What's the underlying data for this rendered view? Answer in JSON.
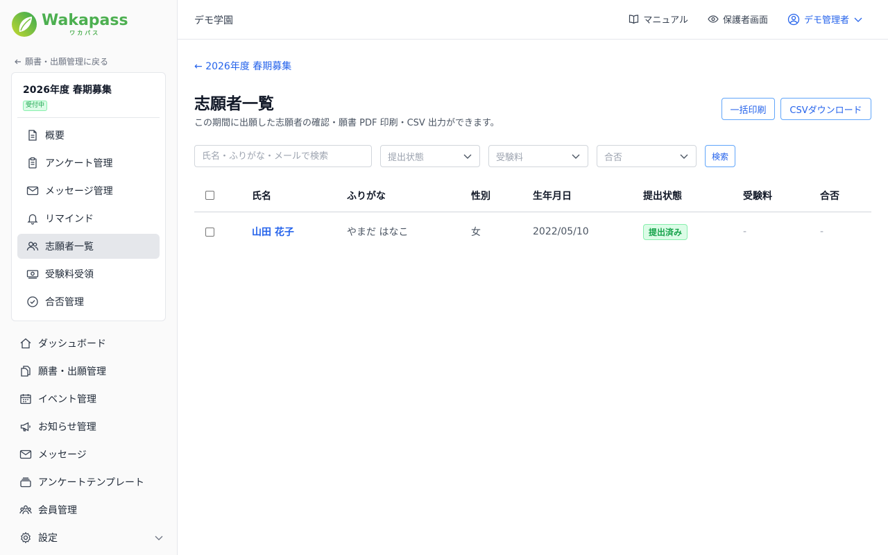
{
  "brand": {
    "name": "Wakapass",
    "kana": "ワカパス",
    "color": "#4caf50"
  },
  "sidebar": {
    "back_label": "願書・出願管理に戻る",
    "period": {
      "title": "2026年度 春期募集",
      "badge": "受付中",
      "items": [
        {
          "label": "概要",
          "icon": "document-icon"
        },
        {
          "label": "アンケート管理",
          "icon": "clipboard-icon"
        },
        {
          "label": "メッセージ管理",
          "icon": "mail-icon"
        },
        {
          "label": "リマインド",
          "icon": "bell-icon"
        },
        {
          "label": "志願者一覧",
          "icon": "users-icon",
          "active": true
        },
        {
          "label": "受験料受領",
          "icon": "cash-icon"
        },
        {
          "label": "合否管理",
          "icon": "check-circle-icon"
        }
      ]
    },
    "main_items": [
      {
        "label": "ダッシュボード",
        "icon": "home-icon"
      },
      {
        "label": "願書・出願管理",
        "icon": "documents-icon"
      },
      {
        "label": "イベント管理",
        "icon": "calendar-icon"
      },
      {
        "label": "お知らせ管理",
        "icon": "megaphone-icon"
      },
      {
        "label": "メッセージ",
        "icon": "mail-icon"
      },
      {
        "label": "アンケートテンプレート",
        "icon": "stack-icon"
      },
      {
        "label": "会員管理",
        "icon": "members-icon"
      },
      {
        "label": "設定",
        "icon": "gear-icon"
      }
    ]
  },
  "header": {
    "school": "デモ学園",
    "manual": "マニュアル",
    "guardian_view": "保護者画面",
    "user": "デモ管理者"
  },
  "main": {
    "crumb": "2026年度 春期募集",
    "title": "志願者一覧",
    "description": "この期間に出願した志願者の確認・願書 PDF 印刷・CSV 出力ができます。",
    "print_button": "一括印刷",
    "csv_button": "CSVダウンロード",
    "search_placeholder": "氏名・ふりがな・メールで検索",
    "filters": {
      "status": "提出状態",
      "fee": "受験料",
      "result": "合否"
    },
    "search_button": "検索"
  },
  "table": {
    "columns": [
      "氏名",
      "ふりがな",
      "性別",
      "生年月日",
      "提出状態",
      "受験料",
      "合否"
    ],
    "rows": [
      {
        "name": "山田 花子",
        "kana": "やまだ はなこ",
        "gender": "女",
        "birth": "2022/05/10",
        "status": "提出済み",
        "fee": "-",
        "result": "-"
      }
    ]
  },
  "colors": {
    "accent": "#2563eb",
    "success": "#16a34a",
    "success_bg": "#dcfce7"
  }
}
